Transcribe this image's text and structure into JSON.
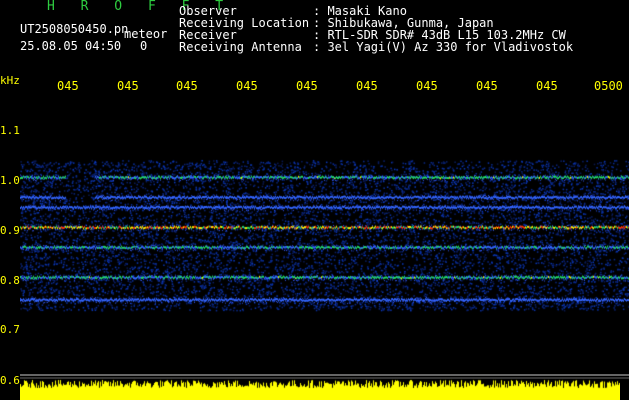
{
  "header": {
    "app_name": "H R O F F T",
    "filename": "UT2508050450.pn",
    "mode": "meteor",
    "datetime": "25.08.05 04:50",
    "counter": "0",
    "observer_label": "Observer",
    "observer_value": ": Masaki Kano",
    "location_label": "Receiving Location",
    "location_value": ": Shibukawa, Gunma, Japan",
    "receiver_label": "Receiver",
    "receiver_value": ": RTL-SDR SDR# 43dB L15 103.2MHz CW",
    "antenna_label": "Receiving Antenna",
    "antenna_value": ": 3el Yagi(V) Az 330 for Vladivostok"
  },
  "axes": {
    "y_unit": "kHz",
    "y_ticks": [
      "1.1",
      "1.0",
      "0.9",
      "0.8",
      "0.7",
      "0.6"
    ],
    "x_ticks": [
      "045",
      "045",
      "045",
      "045",
      "045",
      "045",
      "045",
      "045",
      "045",
      "0500"
    ]
  },
  "colors": {
    "background": "#000000",
    "noise": "#0a1a8c",
    "signal_hot": "#ff3300",
    "signal_warm": "#ffee00",
    "signal_mid": "#22dd66",
    "axis_text": "#ffff00",
    "power_bar": "#ffff00"
  },
  "bands": [
    {
      "freq_khz": 1.005,
      "strength": 0.55
    },
    {
      "freq_khz": 0.965,
      "strength": 0.35
    },
    {
      "freq_khz": 0.945,
      "strength": 0.25
    },
    {
      "freq_khz": 0.905,
      "strength": 0.85
    },
    {
      "freq_khz": 0.865,
      "strength": 0.5
    },
    {
      "freq_khz": 0.805,
      "strength": 0.55
    },
    {
      "freq_khz": 0.76,
      "strength": 0.25
    }
  ]
}
